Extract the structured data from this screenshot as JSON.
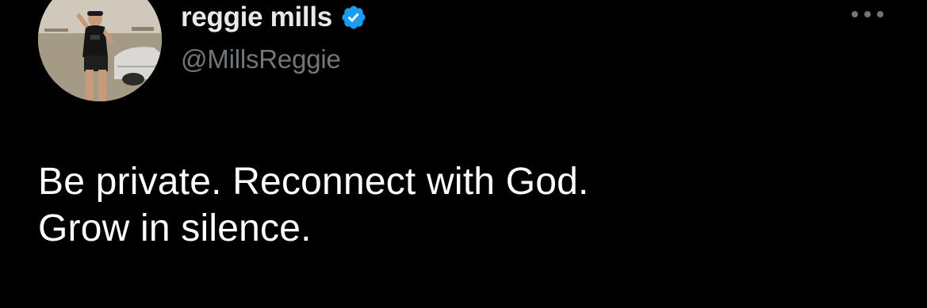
{
  "tweet": {
    "author": {
      "display_name": "reggie mills",
      "handle": "@MillsReggie",
      "verified": true,
      "avatar": "avatar-photo"
    },
    "more_icon": "more-options-icon",
    "text_lines": [
      "Be private. Reconnect with God.",
      "Grow in silence."
    ]
  },
  "colors": {
    "background": "#000000",
    "primary_text": "#ffffff",
    "name_text": "#e7e9ea",
    "secondary_text": "#71767b",
    "verified_badge": "#1d9bf0"
  }
}
